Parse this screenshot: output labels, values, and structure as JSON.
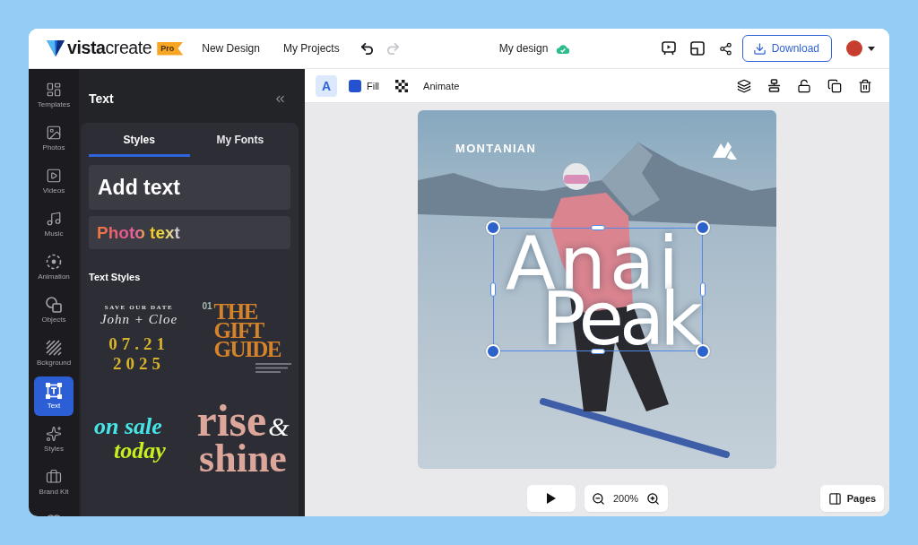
{
  "app_bar": {
    "logo": {
      "wordmark": "**vista**create",
      "badge": "Pro"
    },
    "nav": [
      {
        "label": "New Design"
      },
      {
        "label": "My Projects"
      }
    ],
    "history": [
      {
        "kind": "undo",
        "disabled": false
      },
      {
        "kind": "redo",
        "disabled": true
      }
    ],
    "document": {
      "title": "My design",
      "saved": true
    },
    "download": "Download"
  },
  "rail": {
    "items": [
      {
        "label": "Templates",
        "selected": false
      },
      {
        "label": "Photos",
        "selected": false
      },
      {
        "label": "Videos",
        "selected": false
      },
      {
        "label": "Music",
        "selected": false
      },
      {
        "label": "Animation",
        "selected": false
      },
      {
        "label": "Objects",
        "selected": false
      },
      {
        "label": "Bckground",
        "selected": false
      },
      {
        "label": "Text",
        "selected": true
      },
      {
        "label": "Styles",
        "selected": false
      },
      {
        "label": "Brand Kit",
        "selected": false
      }
    ]
  },
  "panel": {
    "title": "Text",
    "tabs": [
      {
        "label": "Styles",
        "selected": true
      },
      {
        "label": "My Fonts",
        "selected": false
      }
    ],
    "add_text": "Add text",
    "photo_text": "Photo text",
    "section_title": "Text Styles",
    "style_presets": [
      {
        "kind": "save_the_date",
        "overline": "SAVE OUR DATE",
        "names": "John + Cloe",
        "date": "07.21",
        "year": "2025"
      },
      {
        "kind": "gift_guide",
        "number": "01",
        "title": "THE GIFT GUIDE"
      },
      {
        "kind": "sale",
        "lines": [
          "on sale",
          "today"
        ]
      },
      {
        "kind": "rise_shine",
        "top": "rise",
        "ampersand": "&",
        "bottom": "shine"
      }
    ]
  },
  "toolbar": {
    "text_color": {
      "label": "A",
      "selected": true
    },
    "fill": {
      "label": "Fill",
      "color": "#2553d0"
    },
    "animate": "Animate"
  },
  "canvas": {
    "brand": "MONTANIAN",
    "headline": {
      "lines": [
        "Anai",
        "Peak"
      ],
      "selected": true
    }
  },
  "bottom_bar": {
    "zoom": "200%",
    "pages": "Pages"
  }
}
